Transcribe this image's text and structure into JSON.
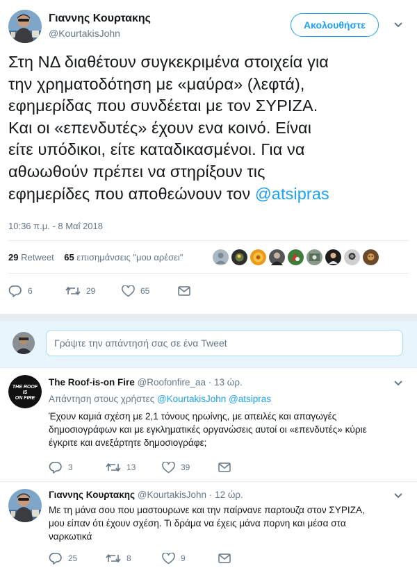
{
  "main": {
    "author_name": "Γιαννης Κουρτακης",
    "author_handle": "@KourtakisJohn",
    "follow_label": "Ακολουθήστε",
    "text_line_1": "Στη ΝΔ διαθέτουν συγκεκριμένα στοιχεία για",
    "text_line_2": "την χρηματοδότηση με «μαύρα» (λεφτά),",
    "text_line_3": "εφημερίδας που συνδέεται με τον ΣΥΡΙΖΑ.",
    "text_line_4": "Και οι «επενδυτές» έχουν ενα κοινό. Είναι",
    "text_line_5": "είτε υπόδικοι, είτε καταδικασμένοι. Για να",
    "text_line_6": "αθωωθούν πρέπει να στηρίξουν τις",
    "text_line_7_pre": "εφημερίδες που αποθεώνουν τον ",
    "text_mention": "@atsipras",
    "timestamp": "10:36 π.μ. - 8 Μαΐ 2018",
    "retweets_count": "29",
    "retweets_label": "Retweet",
    "likes_count": "65",
    "likes_label": "επισημάνσεις \"μου αρέσει\"",
    "actions": {
      "reply": "6",
      "retweet": "29",
      "like": "65"
    }
  },
  "reply_box": {
    "placeholder": "Γράψτε την απάντησή σας σε ένα Tweet"
  },
  "replies": [
    {
      "name": "The Roof-is-on Fire",
      "handle": "@Roofonfire_aa",
      "time": "· 13 ώρ.",
      "avatar_text": "THE ROOF IS ON FIRE",
      "reply_to_label": "Απάντηση στους χρήστες",
      "reply_to_1": "@KourtakisJohn",
      "reply_to_2": "@atsipras",
      "line_1": "Έχουν καμιά σχέση με 2,1 τόνους ηρωίνης, με απειλές και απαγωγές",
      "line_2": "δημοσιογράφων και με εγκληματικές οργανώσεις αυτοί οι «επενδυτές» κύριε",
      "line_3": "έγκριτε και ανεξάρτητε δημοσιογράφε;",
      "actions": {
        "reply": "3",
        "retweet": "13",
        "like": "39"
      }
    },
    {
      "name": "Γιαννης Κουρτακης",
      "handle": "@KourtakisJohn",
      "time": "· 12 ώρ.",
      "line_1": "Με τη μάνα σου που μαστουρωνε και την παίρνανε παρτουζα στον ΣΥΡΙΖΑ,",
      "line_2": "μου είπαν ότι έχουν σχέση. Τι δράμα να έχεις μάνα πορνη και μέσα στα",
      "line_3": "ναρκωτικά",
      "actions": {
        "reply": "25",
        "retweet": "8",
        "like": "9"
      }
    }
  ],
  "colors": {
    "accent": "#1da1f2",
    "text": "#14171a",
    "muted": "#657786",
    "divider": "#e6ecf0",
    "reply_bg": "#e8f5fd"
  },
  "icons": [
    "caret-down-icon",
    "reply-icon",
    "retweet-icon",
    "like-icon",
    "message-icon"
  ]
}
